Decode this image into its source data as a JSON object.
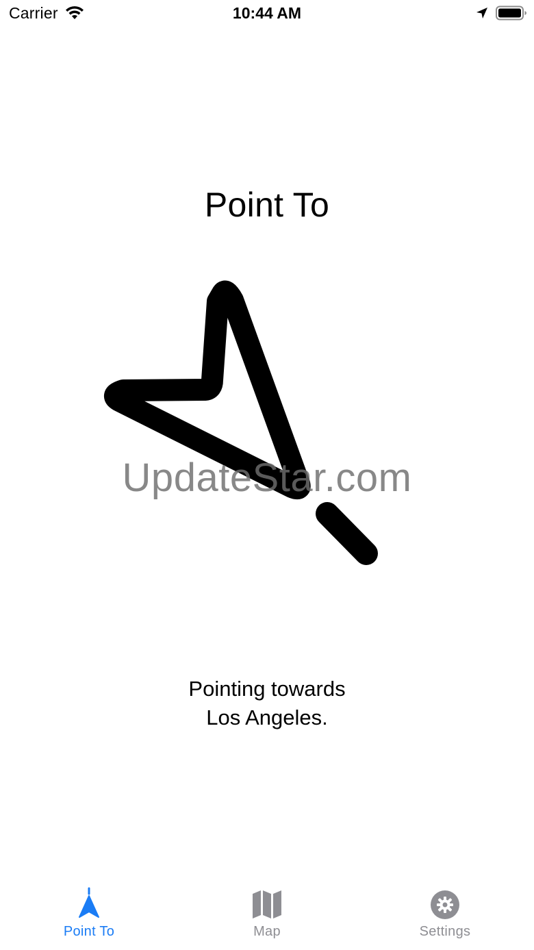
{
  "status_bar": {
    "carrier": "Carrier",
    "time": "10:44 AM"
  },
  "main": {
    "title": "Point To",
    "direction_line1": "Pointing towards",
    "direction_line2": "Los Angeles.",
    "pointer_icon": "navigation-arrow-icon"
  },
  "watermark": "UpdateStar.com",
  "tab_bar": {
    "tabs": [
      {
        "label": "Point To",
        "icon": "location-arrow-icon",
        "active": true
      },
      {
        "label": "Map",
        "icon": "map-icon",
        "active": false
      },
      {
        "label": "Settings",
        "icon": "gear-icon",
        "active": false
      }
    ],
    "active_color": "#1a7cf5",
    "inactive_color": "#8e8e93"
  }
}
